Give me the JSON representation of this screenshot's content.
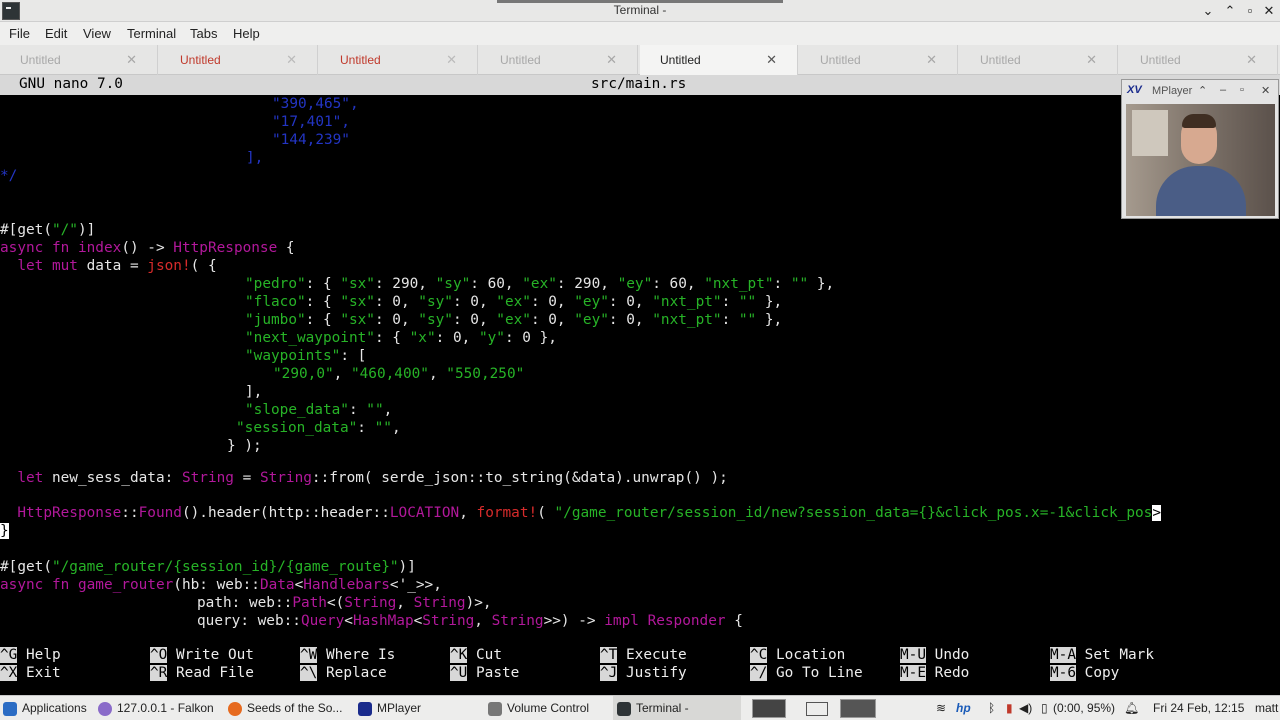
{
  "window": {
    "title": "Terminal -"
  },
  "menubar": [
    "File",
    "Edit",
    "View",
    "Terminal",
    "Tabs",
    "Help"
  ],
  "tabs": [
    {
      "label": "Untitled",
      "state": "normal"
    },
    {
      "label": "Untitled",
      "state": "modified"
    },
    {
      "label": "Untitled",
      "state": "modified"
    },
    {
      "label": "Untitled",
      "state": "normal"
    },
    {
      "label": "Untitled",
      "state": "active"
    },
    {
      "label": "Untitled",
      "state": "normal"
    },
    {
      "label": "Untitled",
      "state": "normal"
    },
    {
      "label": "Untitled",
      "state": "normal"
    }
  ],
  "tab_close_glyph": "✕",
  "nano": {
    "version": "GNU nano 7.0",
    "filename": "src/main.rs"
  },
  "code": {
    "l1": "\"390,465\",",
    "l2": "\"17,401\",",
    "l3": "\"144,239\"",
    "l4": "],",
    "l5": "*/",
    "l8_a": "#[get(",
    "l8_s": "\"/\"",
    "l8_b": ")]",
    "l9_a": "async fn ",
    "l9_b": "index",
    "l9_c": "() -> ",
    "l9_d": "HttpResponse",
    "l9_e": " {",
    "l10_a": "  let mut ",
    "l10_b": "data = ",
    "l10_c": "json!",
    "l10_d": "( {",
    "l11_s1": "\"pedro\"",
    "l11_a": ": { ",
    "l11_s2": "\"sx\"",
    "l11_b": ": 290, ",
    "l11_s3": "\"sy\"",
    "l11_c": ": 60, ",
    "l11_s4": "\"ex\"",
    "l11_d": ": 290, ",
    "l11_s5": "\"ey\"",
    "l11_e": ": 60, ",
    "l11_s6": "\"nxt_pt\"",
    "l11_f": ": ",
    "l11_s7": "\"\"",
    "l11_g": " },",
    "l12_s1": "\"flaco\"",
    "l12_a": ": { ",
    "l12_s2": "\"sx\"",
    "l12_b": ": 0, ",
    "l12_s3": "\"sy\"",
    "l12_c": ": 0, ",
    "l12_s4": "\"ex\"",
    "l12_d": ": 0, ",
    "l12_s5": "\"ey\"",
    "l12_e": ": 0, ",
    "l12_s6": "\"nxt_pt\"",
    "l12_f": ": ",
    "l12_s7": "\"\"",
    "l12_g": " },",
    "l13_s1": "\"jumbo\"",
    "l13_a": ": { ",
    "l13_s2": "\"sx\"",
    "l13_b": ": 0, ",
    "l13_s3": "\"sy\"",
    "l13_c": ": 0, ",
    "l13_s4": "\"ex\"",
    "l13_d": ": 0, ",
    "l13_s5": "\"ey\"",
    "l13_e": ": 0, ",
    "l13_s6": "\"nxt_pt\"",
    "l13_f": ": ",
    "l13_s7": "\"\"",
    "l13_g": " },",
    "l14_s1": "\"next_waypoint\"",
    "l14_a": ": { ",
    "l14_s2": "\"x\"",
    "l14_b": ": 0, ",
    "l14_s3": "\"y\"",
    "l14_c": ": 0 },",
    "l15_s1": "\"waypoints\"",
    "l15_a": ": [",
    "l16_s1": "\"290,0\"",
    "l16_a": ", ",
    "l16_s2": "\"460,400\"",
    "l16_b": ", ",
    "l16_s3": "\"550,250\"",
    "l17": "],",
    "l18_s1": "\"slope_data\"",
    "l18_a": ": ",
    "l18_s2": "\"\"",
    "l18_b": ",",
    "l19_s1": "\"session_data\"",
    "l19_a": ": ",
    "l19_s2": "\"\"",
    "l19_b": ",",
    "l20": "} );",
    "l22_a": "  let ",
    "l22_b": "new_sess_data: ",
    "l22_c": "String",
    "l22_d": " = ",
    "l22_e": "String",
    "l22_f": "::from( serde_json::to_string(&data).unwrap() );",
    "l24_a": "  HttpResponse",
    "l24_b": "::",
    "l24_c": "Found",
    "l24_d": "().header(http::header::",
    "l24_e": "LOCATION",
    "l24_f": ", ",
    "l24_g": "format!",
    "l24_h": "( ",
    "l24_s": "\"/game_router/session_id/new?session_data={}&click_pos.x=-1&click_pos",
    "l24_cursor": ">",
    "l25": "}",
    "l27_a": "#[get(",
    "l27_s": "\"/game_router/{session_id}/{game_route}\"",
    "l27_b": ")]",
    "l28_a": "async fn ",
    "l28_b": "game_router",
    "l28_c": "(hb: web::",
    "l28_d": "Data",
    "l28_e": "<",
    "l28_f": "Handlebars",
    "l28_g": "<'_>>,",
    "l29_a": "path: web::",
    "l29_b": "Path",
    "l29_c": "<(",
    "l29_d": "String",
    "l29_e": ", ",
    "l29_f": "String",
    "l29_g": ")>,",
    "l30_a": "query: web::",
    "l30_b": "Query",
    "l30_c": "<",
    "l30_d": "HashMap",
    "l30_e": "<",
    "l30_f": "String",
    "l30_g": ", ",
    "l30_h": "String",
    "l30_i": ">>) -> ",
    "l30_j": "impl Responder",
    "l30_k": " {"
  },
  "shortcuts": [
    {
      "key": "^G",
      "label": "Help"
    },
    {
      "key": "^X",
      "label": "Exit"
    },
    {
      "key": "^O",
      "label": "Write Out"
    },
    {
      "key": "^R",
      "label": "Read File"
    },
    {
      "key": "^W",
      "label": "Where Is"
    },
    {
      "key": "^\\",
      "label": "Replace"
    },
    {
      "key": "^K",
      "label": "Cut"
    },
    {
      "key": "^U",
      "label": "Paste"
    },
    {
      "key": "^T",
      "label": "Execute"
    },
    {
      "key": "^J",
      "label": "Justify"
    },
    {
      "key": "^C",
      "label": "Location"
    },
    {
      "key": "^/",
      "label": "Go To Line"
    },
    {
      "key": "M-U",
      "label": "Undo"
    },
    {
      "key": "M-E",
      "label": "Redo"
    },
    {
      "key": "M-A",
      "label": "Set Mark"
    },
    {
      "key": "M-6",
      "label": "Copy"
    }
  ],
  "mplayer": {
    "title": "MPlayer",
    "logo": "XV"
  },
  "taskbar": {
    "applications": "Applications",
    "items": [
      "127.0.0.1 - Falkon",
      "Seeds of the So...",
      "MPlayer",
      "Volume Control",
      "Terminal -"
    ],
    "battery": "(0:00, 95%)",
    "datetime": "Fri 24 Feb, 12:15",
    "user": "matt"
  },
  "colors": {
    "keyword": "#b2189b",
    "macro": "#d62b2b",
    "string": "#27b327",
    "comment": "#2335c4",
    "modified_tab": "#c0392b"
  }
}
